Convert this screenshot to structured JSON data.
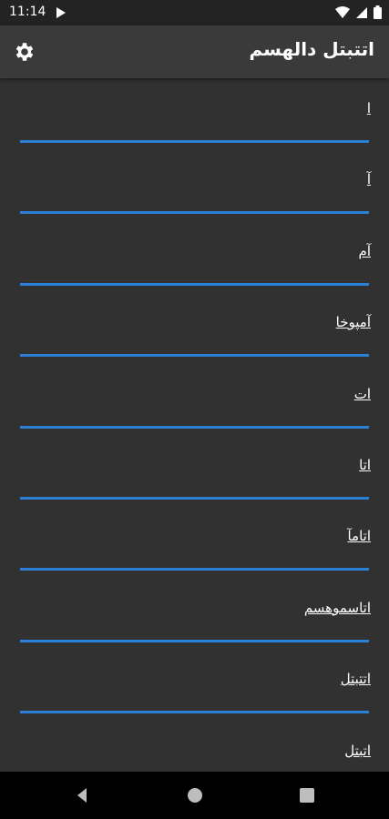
{
  "status_bar": {
    "time": "11:14",
    "icons": [
      "play-store-icon",
      "wifi-icon",
      "signal-icon",
      "battery-icon"
    ]
  },
  "app_bar": {
    "title": "اتتبتل دالهسم",
    "settings_icon": "gear-icon"
  },
  "list": {
    "items": [
      {
        "label": "ا"
      },
      {
        "label": "آ"
      },
      {
        "label": "آم"
      },
      {
        "label": "آمپوخا"
      },
      {
        "label": "ات"
      },
      {
        "label": "اتا"
      },
      {
        "label": "اتامآ"
      },
      {
        "label": "اتاسموهسم"
      },
      {
        "label": "اتتبتل"
      },
      {
        "label": "اتبتل"
      }
    ],
    "divider_color": "#2b7fd6"
  },
  "nav_bar": {
    "icons": [
      "back-icon",
      "home-icon",
      "recents-icon"
    ]
  }
}
